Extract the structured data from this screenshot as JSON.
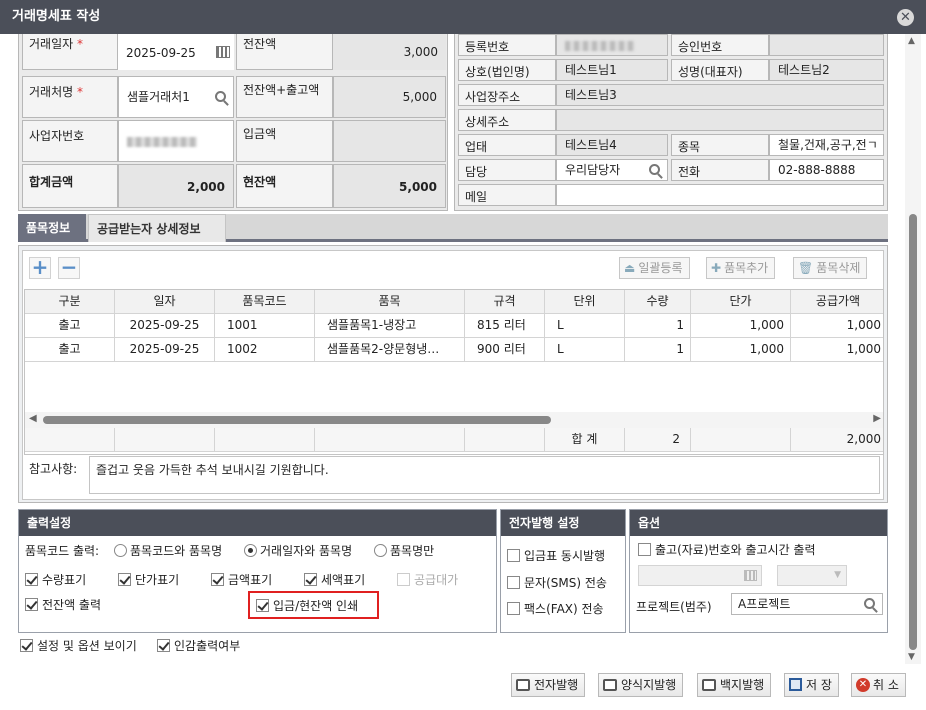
{
  "window": {
    "title": "거래명세표 작성"
  },
  "left_form": {
    "trade_date_label": "거래일자",
    "trade_date_value": "2025-09-25",
    "prev_balance_label": "전잔액",
    "prev_balance_value": "3,000",
    "partner_label": "거래처명",
    "partner_value": "샘플거래처1",
    "prev_plus_out_label": "전잔액+출고액",
    "prev_plus_out_value": "5,000",
    "bizno_label": "사업자번호",
    "deposit_label": "입금액",
    "deposit_value": "",
    "total_label": "합계금액",
    "total_value": "2,000",
    "cur_balance_label": "현잔액",
    "cur_balance_value": "5,000",
    "required_mark": "*"
  },
  "right_form": {
    "regno_label": "등록번호",
    "approval_label": "승인번호",
    "approval_value": "",
    "company_label": "상호(법인명)",
    "company_value": "테스트님1",
    "ceo_label": "성명(대표자)",
    "ceo_value": "테스트님2",
    "address_label": "사업장주소",
    "address_value": "테스트님3",
    "address_detail_label": "상세주소",
    "address_detail_value": "",
    "biz_type_label": "업태",
    "biz_type_value": "테스트님4",
    "biz_item_label": "종목",
    "biz_item_value": "철물,건재,공구,전ㄱ",
    "manager_label": "담당",
    "manager_value": "우리담당자",
    "phone_label": "전화",
    "phone_value": "02-888-8888",
    "email_label": "메일",
    "email_value": ""
  },
  "tabs": [
    {
      "label": "품목정보"
    },
    {
      "label": "공급받는자 상세정보"
    }
  ],
  "toolbar": {
    "bulk_register": "일괄등록",
    "add_item": "품목추가",
    "delete_item": "품목삭제"
  },
  "table": {
    "columns": [
      "구분",
      "일자",
      "품목코드",
      "품목",
      "규격",
      "단위",
      "수량",
      "단가",
      "공급가액"
    ],
    "rows": [
      [
        "출고",
        "2025-09-25",
        "1001",
        "샘플품목1-냉장고",
        "815 리터",
        "L",
        "1",
        "1,000",
        "1,000"
      ],
      [
        "출고",
        "2025-09-25",
        "1002",
        "샘플품목2-양문형냉…",
        "900 리터",
        "L",
        "1",
        "1,000",
        "1,000"
      ]
    ],
    "total_label": "합 계",
    "total_qty": "2",
    "total_amount": "2,000"
  },
  "memo": {
    "label": "참고사항:",
    "value": "즐겁고 웃음 가득한 추석 보내시길 기원합니다."
  },
  "output_settings": {
    "title": "출력설정",
    "code_output_label": "품목코드 출력:",
    "radio_code_name": "품목코드와 품목명",
    "radio_date_name": "거래일자와 품목명",
    "radio_name_only": "품목명만",
    "qty_display": "수량표기",
    "price_display": "단가표기",
    "amount_display": "금액표기",
    "tax_display": "세액표기",
    "supply_price": "공급대가",
    "prev_balance_output": "전잔액 출력",
    "deposit_balance_print": "입금/현잔액 인쇄"
  },
  "einvoice_settings": {
    "title": "전자발행 설정",
    "concurrent": "입금표 동시발행",
    "sms": "문자(SMS) 전송",
    "fax": "팩스(FAX) 전송"
  },
  "options": {
    "title": "옵션",
    "print_out_no": "출고(자료)번호와 출고시간 출력",
    "project_label": "프로젝트(범주)",
    "project_value": "A프로젝트"
  },
  "bottom": {
    "show_settings": "설정 및 옵션 보이기",
    "stamp_output": "인감출력여부"
  },
  "buttons": {
    "e_issue": "전자발행",
    "form_issue": "양식지발행",
    "blank_issue": "백지발행",
    "save": "저 장",
    "cancel": "취 소"
  },
  "colors": {
    "titlebar": "#4b4f59",
    "highlight_border": "#e02020"
  }
}
